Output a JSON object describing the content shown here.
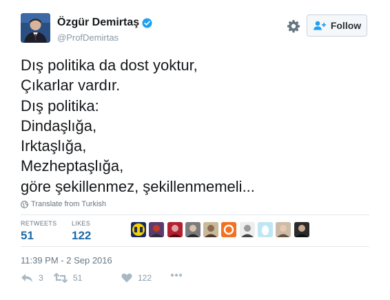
{
  "user": {
    "display_name": "Özgür Demirtaş",
    "handle": "@ProfDemirtas",
    "verified": true
  },
  "header": {
    "follow_label": "Follow",
    "settings_icon": "gear-icon",
    "follow_icon": "add-user-icon"
  },
  "tweet": {
    "lines": [
      "Dış politika da dost yoktur,",
      "Çıkarlar vardır.",
      "Dış politika:",
      "Dindaşlığa,",
      "Irktaşlığa,",
      "Mezheptaşlığa,",
      "göre şekillenmez, şekillenmemeli..."
    ],
    "translate_label": "Translate from Turkish",
    "timestamp": "11:39 PM - 2 Sep 2016"
  },
  "stats": {
    "retweets_label": "RETWEETS",
    "retweets_value": "51",
    "likes_label": "LIKES",
    "likes_value": "122"
  },
  "actions": {
    "reply_count": "3",
    "retweet_count": "51",
    "like_count": "122"
  },
  "colors": {
    "accent": "#1b6aa8",
    "verified": "#1da1f2",
    "muted": "#8899a6"
  }
}
